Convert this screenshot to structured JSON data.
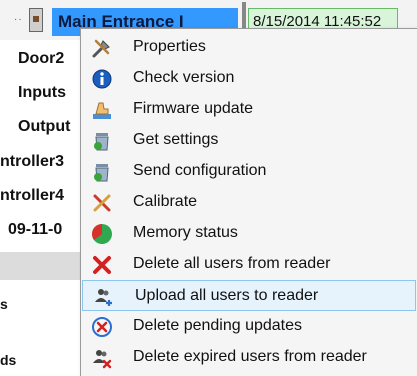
{
  "tree": {
    "selected_node": "Main Entrance I",
    "timestamp": "8/15/2014 11:45:52",
    "rows": [
      "Door2",
      "Inputs",
      "Output",
      "ntroller3",
      "ntroller4",
      "09-11-0",
      "s",
      "ds"
    ]
  },
  "menu": {
    "highlighted_index": 8,
    "items": [
      {
        "label": "Properties",
        "icon": "tools-icon"
      },
      {
        "label": "Check version",
        "icon": "info-icon"
      },
      {
        "label": "Firmware update",
        "icon": "hand-update-icon"
      },
      {
        "label": "Get settings",
        "icon": "trash-settings-icon"
      },
      {
        "label": "Send configuration",
        "icon": "trash-send-icon"
      },
      {
        "label": "Calibrate",
        "icon": "calibrate-tools-icon"
      },
      {
        "label": "Memory status",
        "icon": "pie-chart-icon"
      },
      {
        "label": "Delete all users from reader",
        "icon": "red-x-icon"
      },
      {
        "label": "Upload all users to reader",
        "icon": "users-plus-icon"
      },
      {
        "label": "Delete pending updates",
        "icon": "pending-delete-icon"
      },
      {
        "label": "Delete expired users from reader",
        "icon": "users-x-icon"
      }
    ]
  },
  "colors": {
    "selection": "#3399ff",
    "highlight_bg": "#e6f3fc",
    "highlight_border": "#8cc6ee",
    "timestamp_bg": "#d9f5d9"
  }
}
